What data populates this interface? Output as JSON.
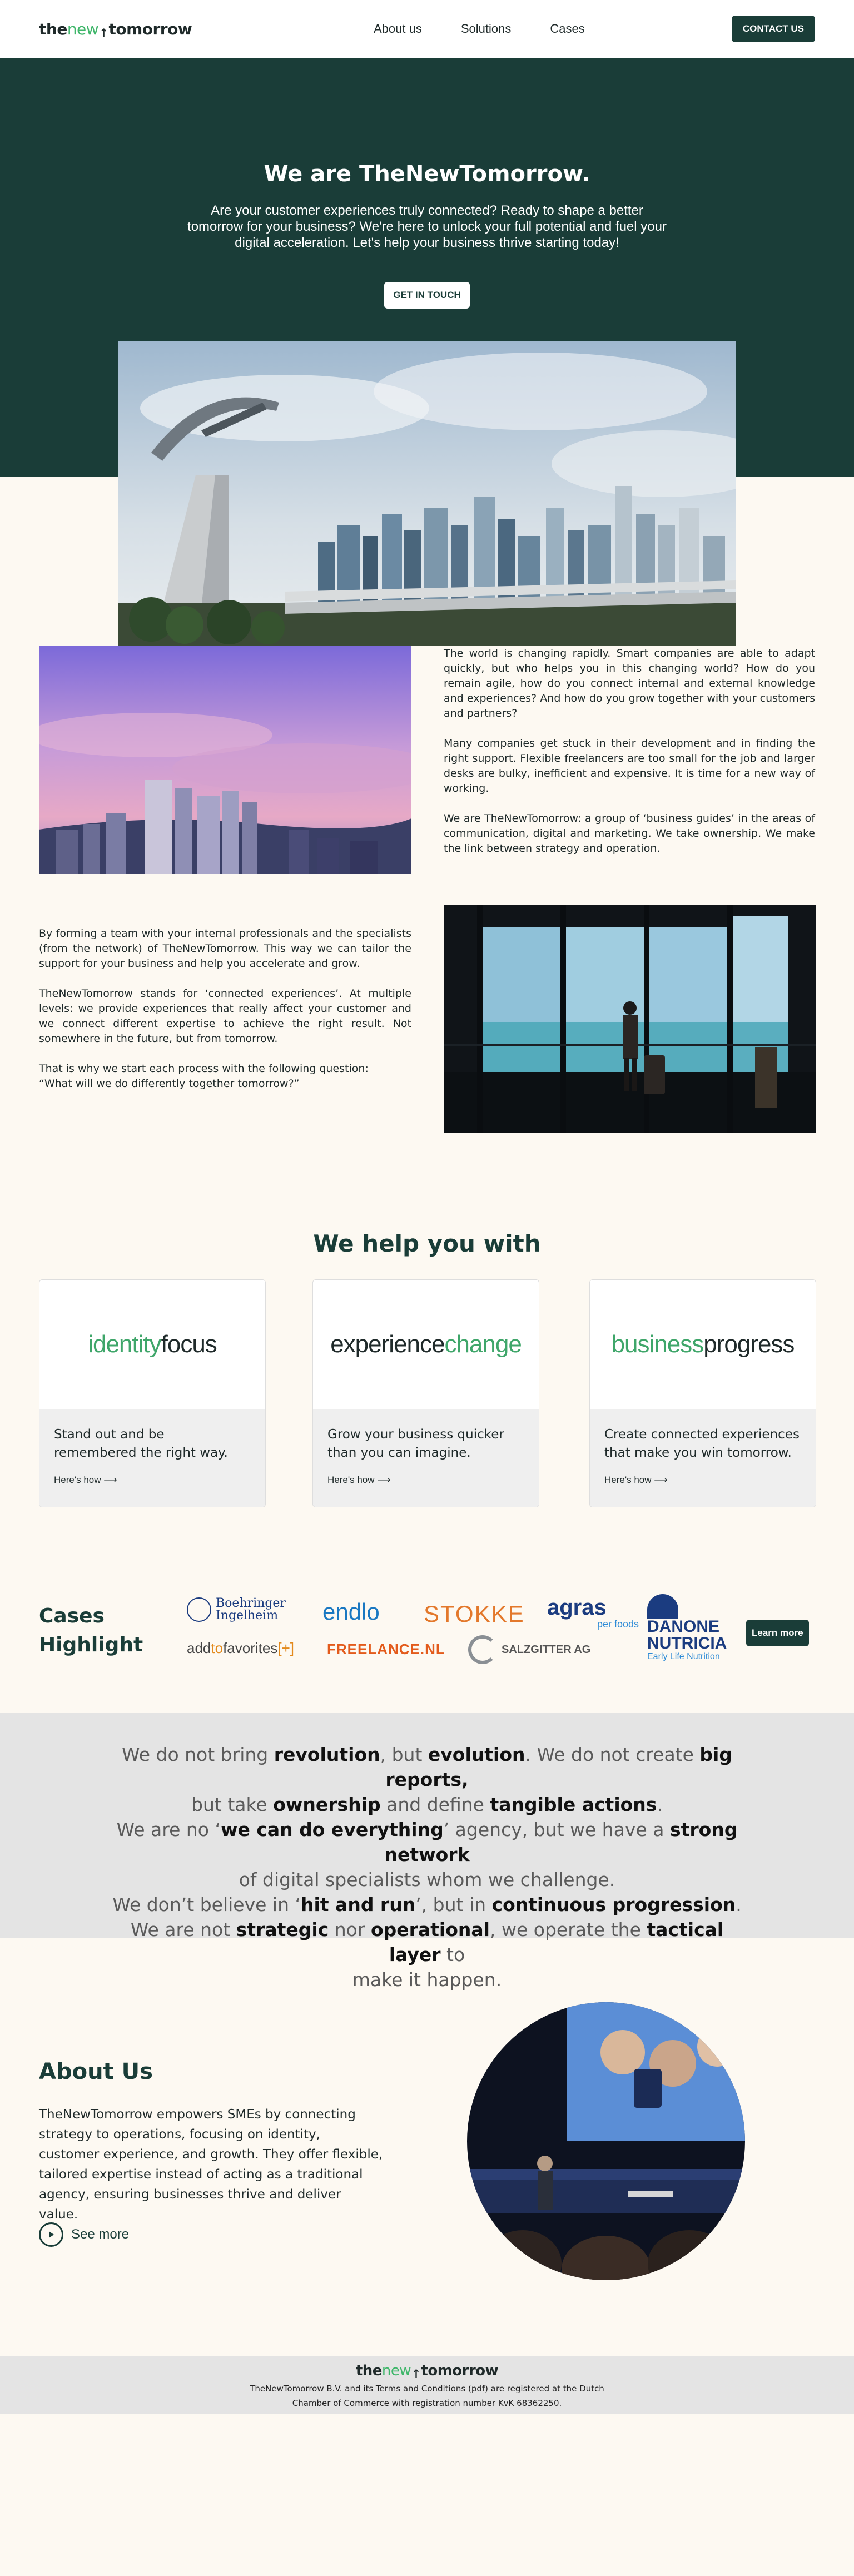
{
  "brand": {
    "part1": "the",
    "part2": "new",
    "part3": "tomorrow",
    "accent": "#3fb66a",
    "dark": "#1a3d38"
  },
  "nav": {
    "links": [
      "About us",
      "Solutions",
      "Cases"
    ],
    "cta": "CONTACT US"
  },
  "hero": {
    "title": "We are TheNewTomorrow.",
    "text": "Are your customer experiences truly connected? Ready to shape a better tomorrow for your business? We're here to unlock your full potential and fuel your digital acceleration. Let's help your business thrive starting today!",
    "cta": "GET IN TOUCH"
  },
  "intro": {
    "p1": "The world is changing rapidly. Smart companies are able to adapt quickly, but who helps you in this changing world? How do you remain agile, how do you connect internal and external knowledge and experiences? And how do you grow together with your customers and partners?",
    "p2": "Many companies get stuck in their development and in finding the right support. Flexible freelancers are too small for the job and larger desks are bulky, inefficient and expensive. It is time for a new way of working.",
    "p3": "We are TheNewTomorrow: a group of ‘business guides’ in the areas of communication, digital and marketing. We take ownership. We make the link between strategy and operation."
  },
  "team": {
    "p1": "By forming a team with your internal professionals and the specialists (from the network) of TheNewTomorrow. This way we can tailor the support for your business and help you accelerate and grow.",
    "p2": "TheNewTomorrow stands for ‘connected experiences’. At multiple levels: we provide experiences that really affect your customer and we connect different expertise to achieve the right result. Not somewhere in the future, but from tomorrow.",
    "p3a": "That is why we start each process with the following question:",
    "p3b": "“What will we do differently together tomorrow?”"
  },
  "help": {
    "title": "We help you with",
    "cards": [
      {
        "logo_a": "identity",
        "logo_b": "focus",
        "text": "Stand out and be remembered the right way.",
        "link": "Here's how ⟶"
      },
      {
        "logo_a": "experience",
        "logo_b": "change",
        "text": "Grow your business quicker than you can imagine.",
        "link": "Here's how ⟶"
      },
      {
        "logo_a": "business",
        "logo_b": "progress",
        "text": "Create connected experiences that make you win tomorrow.",
        "link": "Here's how ⟶"
      }
    ]
  },
  "cases": {
    "title_line1": "Cases",
    "title_line2": "Highlight",
    "learn_more": "Learn more",
    "logos": {
      "boehringer1": "Boehringer",
      "boehringer2": "Ingelheim",
      "endlo": "endlo",
      "stokke": "STOKKE",
      "agras1": "agras",
      "agras2": "per foods",
      "danone1": "DANONE",
      "danone2": "NUTRICIA",
      "danone3": "Early Life Nutrition",
      "addto1": "add",
      "addto2": "to",
      "addto3": "favorites",
      "addto4": "[+]",
      "freelance": "FREELANCE.NL",
      "salzgitter": "SALZGITTER AG"
    }
  },
  "statement": {
    "l1a": "We do not bring ",
    "l1b": "revolution",
    "l1c": ", but ",
    "l1d": "evolution",
    "l1e": ". We do not create ",
    "l1f": "big reports,",
    "l2a": "but take ",
    "l2b": "ownership",
    "l2c": " and define ",
    "l2d": "tangible actions",
    "l2e": ".",
    "l3a": "We are no ‘",
    "l3b": "we can do everything",
    "l3c": "’ agency, but we have a ",
    "l3d": "strong network",
    "l4a": "of digital specialists whom we challenge.",
    "l5a": "We don’t believe in ‘",
    "l5b": "hit and run",
    "l5c": "’, but in ",
    "l5d": "continuous progression",
    "l5e": ".",
    "l6a": "We are not ",
    "l6b": "strategic",
    "l6c": " nor ",
    "l6d": "operational",
    "l6e": ", we operate the ",
    "l6f": "tactical layer",
    "l6g": " to",
    "l7a": "make it happen."
  },
  "about": {
    "title": "About Us",
    "text": "TheNewTomorrow empowers SMEs by connecting strategy to operations, focusing on identity, customer experience, and growth. They offer flexible, tailored expertise instead of acting as a traditional agency, ensuring businesses thrive and deliver value.",
    "see_more": "See more"
  },
  "footer": {
    "line1": "TheNewTomorrow B.V. and its Terms and Conditions (pdf) are registered at the Dutch",
    "line2": "Chamber of Commerce with registration number KvK 68362250."
  }
}
